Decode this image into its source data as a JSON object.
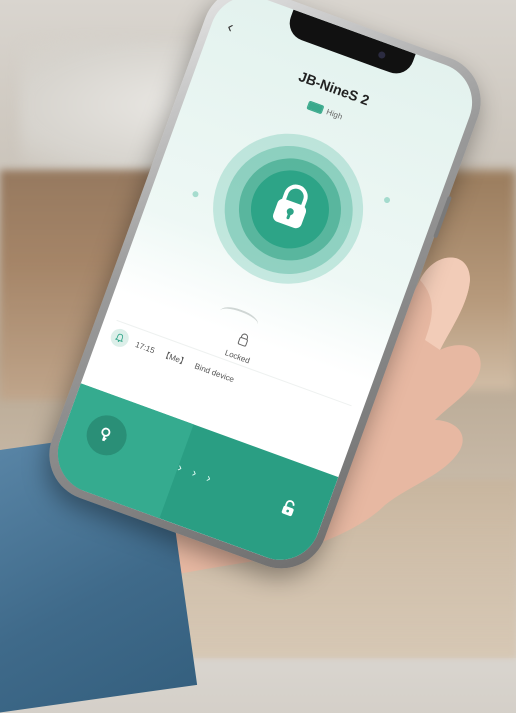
{
  "app": {
    "back_icon": "back-chevron-icon",
    "device_name": "JB-NineS 2"
  },
  "battery": {
    "icon": "battery-icon",
    "level_label": "High",
    "color": "#3aa98c"
  },
  "lock_visual": {
    "icon": "padlock-icon",
    "accent": "#2da487"
  },
  "status": {
    "icon": "small-lock-icon",
    "label": "Locked"
  },
  "log": {
    "icon": "bell-icon",
    "time": "17:15",
    "tag": "【Me】",
    "action": "Bind device"
  },
  "bottom_bar": {
    "key_icon": "key-icon",
    "chevrons": "› › ›",
    "unlock_icon": "unlock-icon",
    "color": "#2a9e83"
  }
}
